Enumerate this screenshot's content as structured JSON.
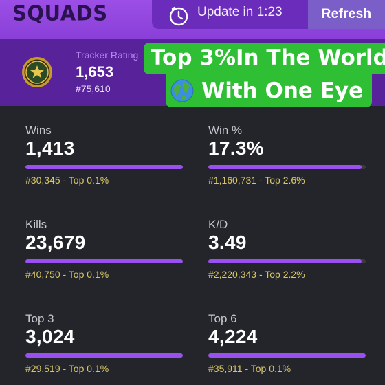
{
  "header": {
    "title": "SQUADS",
    "update_text": "Update in 1:23",
    "refresh_label": "Refresh",
    "accent_color": "#9b4fe6"
  },
  "rating": {
    "label": "Tracker Rating",
    "value": "1,653",
    "rank": "#75,610"
  },
  "overlay": {
    "line1": "Top 3%In The World",
    "line2": "With One Eye",
    "icon": "globe-icon"
  },
  "stats": [
    {
      "label": "Wins",
      "value": "1,413",
      "rank": "#30,345 - Top 0.1%",
      "fill": 1.0
    },
    {
      "label": "Win %",
      "value": "17.3%",
      "rank": "#1,160,731 - Top 2.6%",
      "fill": 0.975
    },
    {
      "label": "Kills",
      "value": "23,679",
      "rank": "#40,750 - Top 0.1%",
      "fill": 1.0
    },
    {
      "label": "K/D",
      "value": "3.49",
      "rank": "#2,220,343 - Top 2.2%",
      "fill": 0.975
    },
    {
      "label": "Top 3",
      "value": "3,024",
      "rank": "#29,519 - Top 0.1%",
      "fill": 1.0
    },
    {
      "label": "Top 6",
      "value": "4,224",
      "rank": "#35,911 - Top 0.1%",
      "fill": 1.0
    }
  ]
}
